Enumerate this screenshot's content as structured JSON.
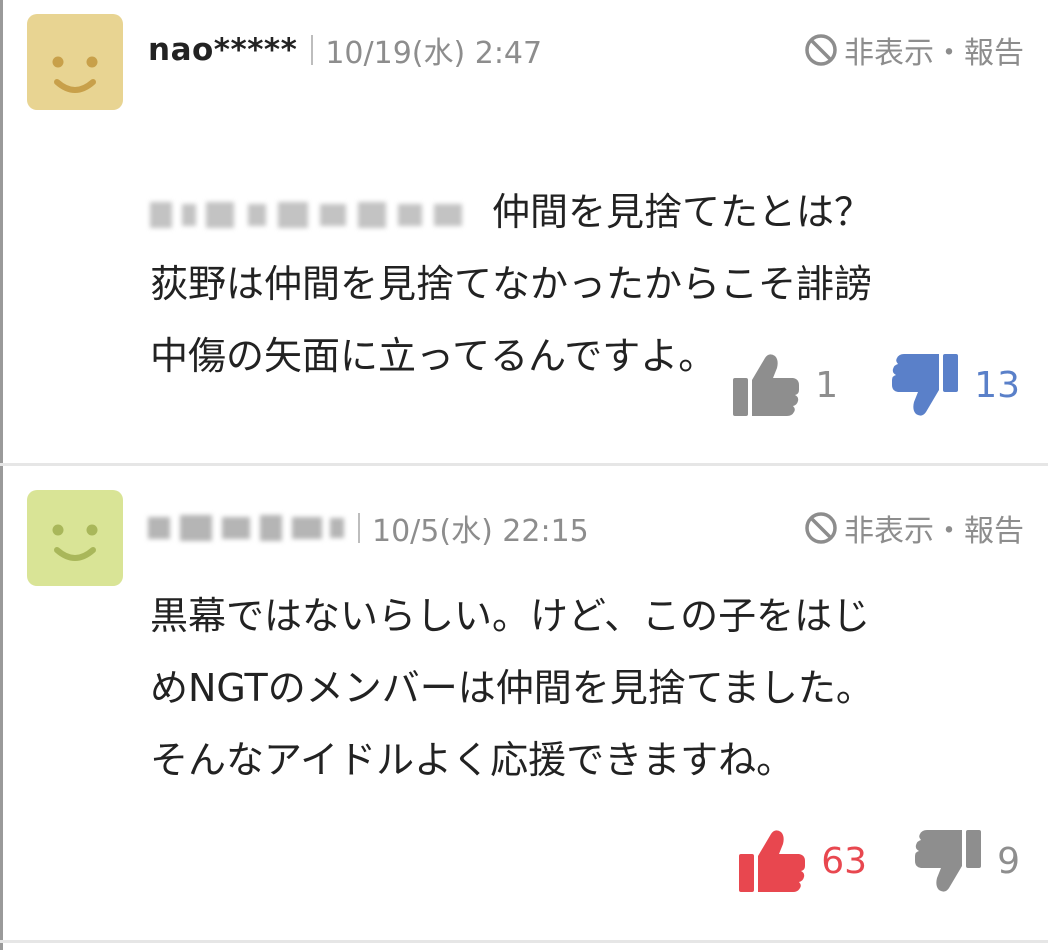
{
  "colors": {
    "avatar1_bg": "#e8d492",
    "avatar1_face": "#c8a04a",
    "avatar2_bg": "#d9e496",
    "avatar2_face": "#a9b75a",
    "gray_icon": "#8e8e8e",
    "downvote_active": "#5a80c9",
    "upvote_active": "#e8474f",
    "meta_text": "#8d8d8d"
  },
  "comments": [
    {
      "username": "nao*****",
      "date": "10/19(水) 2:47",
      "hide_report": "非表示・報告",
      "text_first_line": "仲間を見捨てたとは？",
      "text_rest": "荻野は仲間を見捨てなかったからこそ誹謗\n中傷の矢面に立ってるんですよ。",
      "likes": "1",
      "dislikes": "13",
      "avatar_icon": "smiley-avatar-icon"
    },
    {
      "username": "",
      "date": "10/5(水) 22:15",
      "hide_report": "非表示・報告",
      "text": "黒幕ではないらしい。けど、この子をはじ\nめNGTのメンバーは仲間を見捨てました。\nそんなアイドルよく応援できますね。",
      "likes": "63",
      "dislikes": "9",
      "avatar_icon": "smiley-avatar-icon"
    }
  ]
}
